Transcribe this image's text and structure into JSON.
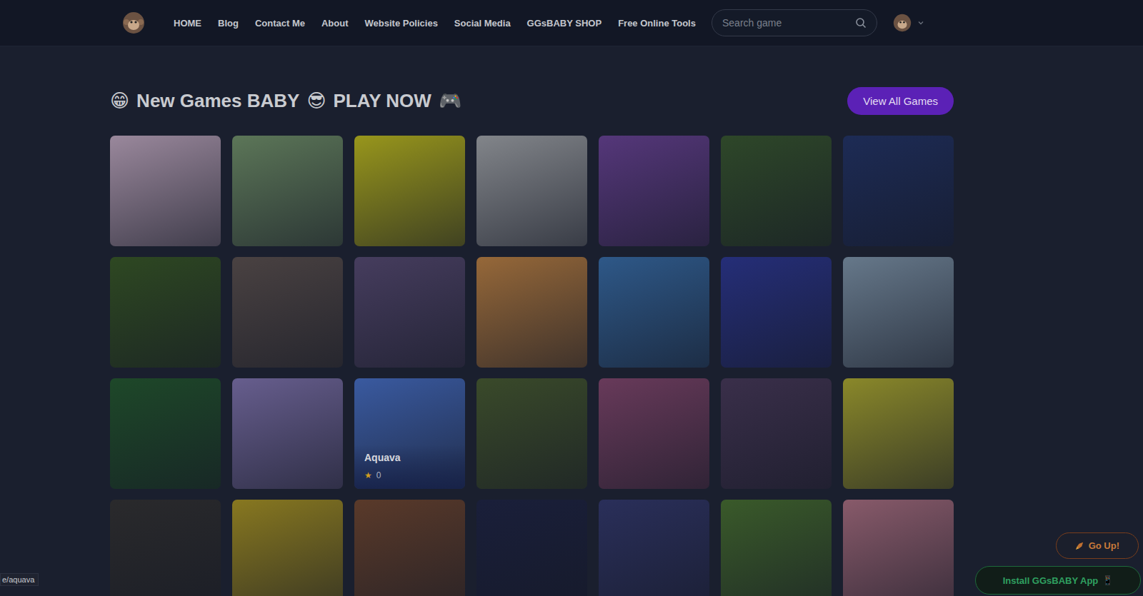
{
  "header": {
    "nav_items": [
      "HOME",
      "Blog",
      "Contact Me",
      "About",
      "Website Policies",
      "Social Media",
      "GGsBABY SHOP",
      "Free Online Tools"
    ],
    "search": {
      "placeholder": "Search game"
    }
  },
  "section": {
    "title": [
      {
        "text": "😁",
        "kind": "emoji"
      },
      {
        "text": "New Games BABY",
        "kind": "text"
      },
      {
        "text": "😎",
        "kind": "emoji"
      },
      {
        "text": "PLAY NOW",
        "kind": "text"
      },
      {
        "text": "🎮",
        "kind": "emoji"
      }
    ],
    "view_all": "View All Games"
  },
  "games": [
    {
      "color": "#9a889c",
      "hovered": false
    },
    {
      "color": "#5c7658",
      "hovered": false
    },
    {
      "color": "#98961c",
      "hovered": false
    },
    {
      "color": "#82858a",
      "hovered": false
    },
    {
      "color": "#55377a",
      "hovered": false
    },
    {
      "color": "#2e4729",
      "hovered": false
    },
    {
      "color": "#1d2b55",
      "hovered": false
    },
    {
      "color": "#2e4822",
      "hovered": false
    },
    {
      "color": "#4a4242",
      "hovered": false
    },
    {
      "color": "#463d5e",
      "hovered": false
    },
    {
      "color": "#966839",
      "hovered": false
    },
    {
      "color": "#2e5888",
      "hovered": false
    },
    {
      "color": "#252e78",
      "hovered": false
    },
    {
      "color": "#66788a",
      "hovered": false
    },
    {
      "color": "#1e4829",
      "hovered": false
    },
    {
      "color": "#675e8e",
      "hovered": false
    },
    {
      "color": "#3a5aa0",
      "hovered": true,
      "label": "Aquava",
      "star": "★",
      "rating": "0"
    },
    {
      "color": "#3a4a2a",
      "hovered": false
    },
    {
      "color": "#683a5a",
      "hovered": false
    },
    {
      "color": "#3a2f4a",
      "hovered": false
    },
    {
      "color": "#8a882a",
      "hovered": false
    },
    {
      "color": "#2a2a2c",
      "hovered": false
    },
    {
      "color": "#887820",
      "hovered": false
    },
    {
      "color": "#5a3a2a",
      "hovered": false
    },
    {
      "color": "#1a1f3a",
      "hovered": false
    },
    {
      "color": "#2a2f5a",
      "hovered": false
    },
    {
      "color": "#3a5a2a",
      "hovered": false
    },
    {
      "color": "#885a6a",
      "hovered": false
    }
  ],
  "floating": {
    "go_up": "Go Up!",
    "install": "Install GGsBABY App",
    "install_icon": "📱"
  },
  "status_url": "e/aquava"
}
